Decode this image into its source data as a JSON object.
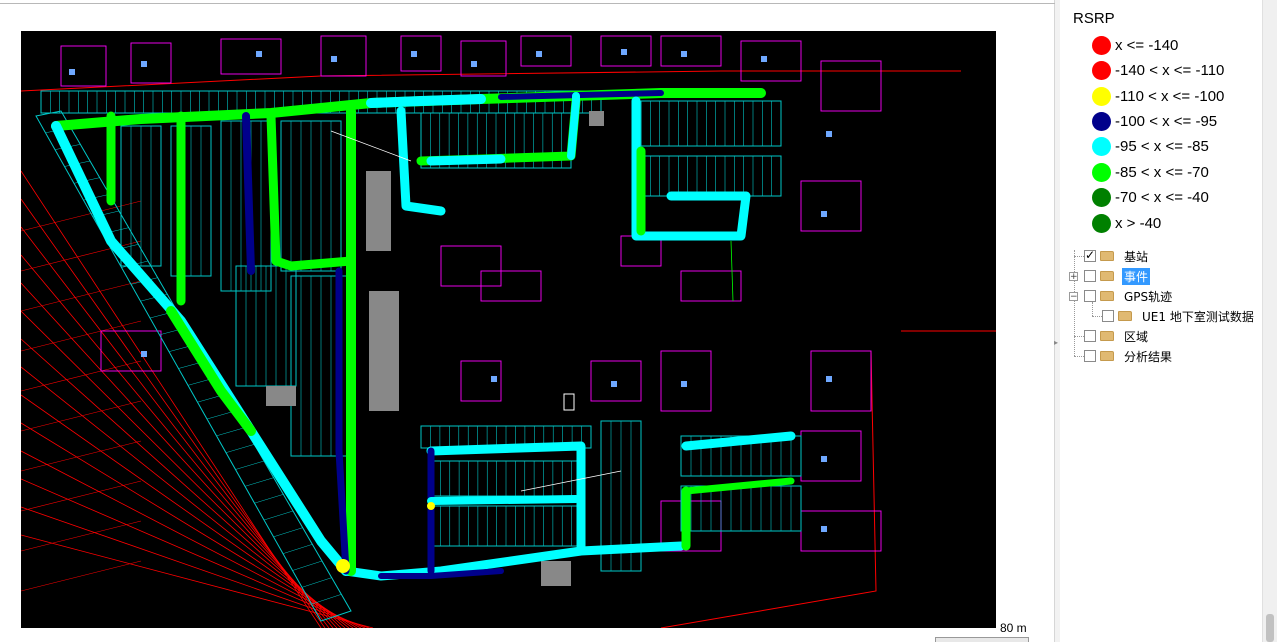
{
  "legend": {
    "title": "RSRP",
    "items": [
      {
        "label": "x <= -140",
        "color": "#ff0000"
      },
      {
        "label": "-140 < x <= -110",
        "color": "#ff0000"
      },
      {
        "label": "-110 < x <= -100",
        "color": "#ffff00"
      },
      {
        "label": "-100 < x <= -95",
        "color": "#00008b"
      },
      {
        "label": "-95 < x <= -85",
        "color": "#00ffff"
      },
      {
        "label": "-85 < x <= -70",
        "color": "#00ff00"
      },
      {
        "label": "-70 < x <= -40",
        "color": "#008000"
      },
      {
        "label": "x > -40",
        "color": "#008000"
      }
    ]
  },
  "layer_tree": [
    {
      "label": "基站",
      "checked": true,
      "expander": "",
      "selected": false
    },
    {
      "label": "事件",
      "checked": false,
      "expander": "+",
      "selected": true
    },
    {
      "label": "GPS轨迹",
      "checked": false,
      "expander": "−",
      "selected": false
    },
    {
      "label": "UE1 地下室测试数据",
      "checked": false,
      "expander": "",
      "selected": false
    },
    {
      "label": "区域",
      "checked": false,
      "expander": "",
      "selected": false
    },
    {
      "label": "分析结果",
      "checked": false,
      "expander": "",
      "selected": false
    }
  ],
  "map": {
    "scale_label": "80 m",
    "background": "#000000",
    "line_colors": {
      "building": "#ff00ff",
      "road": "#ff0000",
      "parking": "#00c8c8",
      "fill": "#888888"
    }
  }
}
